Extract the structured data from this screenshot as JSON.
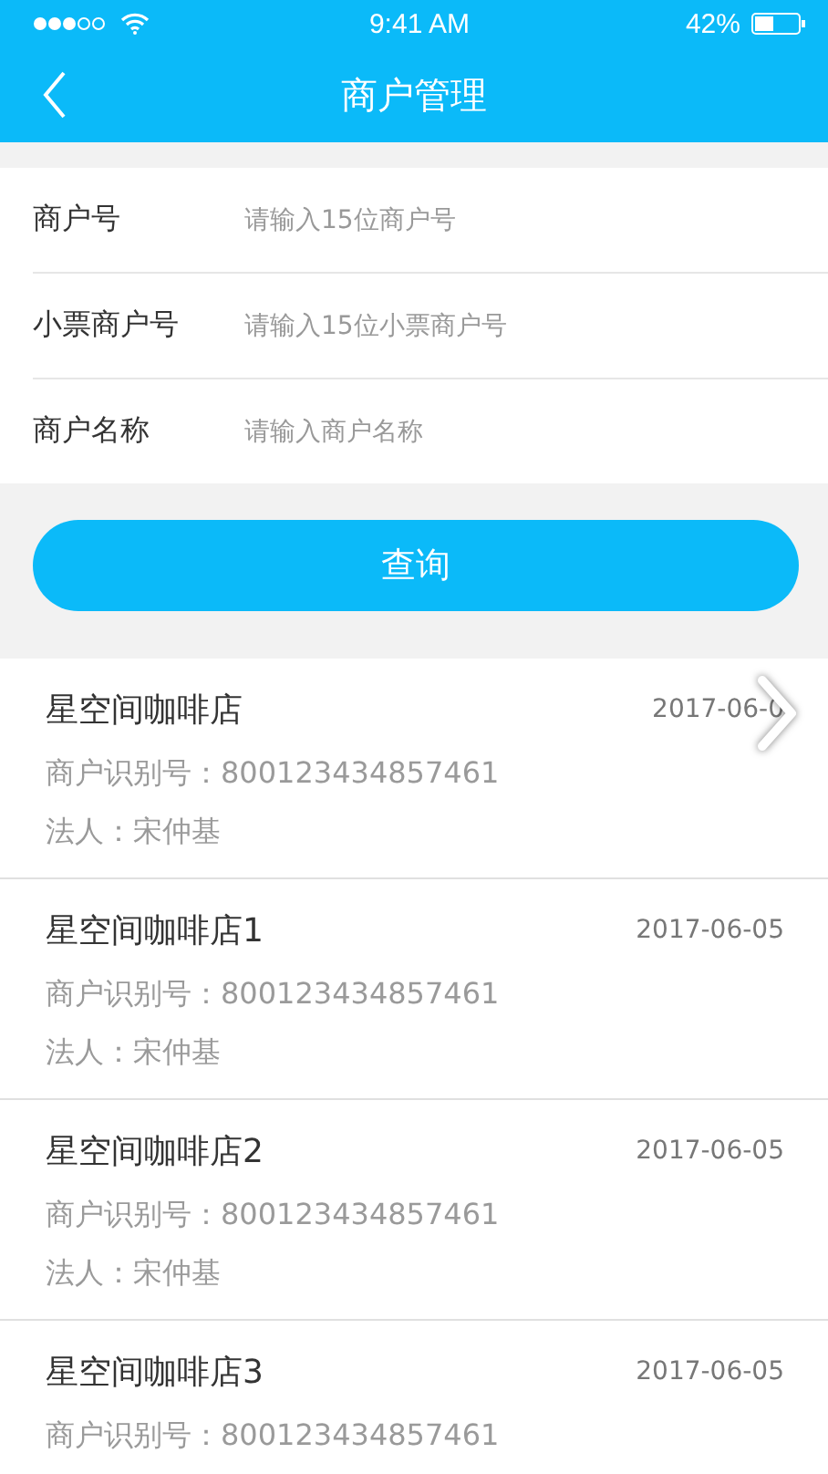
{
  "status_bar": {
    "time": "9:41 AM",
    "battery": "42%"
  },
  "nav": {
    "title": "商户管理"
  },
  "form": {
    "fields": [
      {
        "label": "商户号",
        "placeholder": "请输入15位商户号"
      },
      {
        "label": "小票商户号",
        "placeholder": "请输入15位小票商户号"
      },
      {
        "label": "商户名称",
        "placeholder": "请输入商户名称"
      }
    ],
    "button": "查询"
  },
  "merchants": [
    {
      "name": "星空间咖啡店",
      "date": "2017-06-0",
      "id_line": "商户识别号：800123434857461",
      "legal_line": "法人：宋仲基"
    },
    {
      "name": "星空间咖啡店1",
      "date": "2017-06-05",
      "id_line": "商户识别号：800123434857461",
      "legal_line": "法人：宋仲基"
    },
    {
      "name": "星空间咖啡店2",
      "date": "2017-06-05",
      "id_line": "商户识别号：800123434857461",
      "legal_line": "法人：宋仲基"
    },
    {
      "name": "星空间咖啡店3",
      "date": "2017-06-05",
      "id_line": "商户识别号：800123434857461"
    }
  ]
}
